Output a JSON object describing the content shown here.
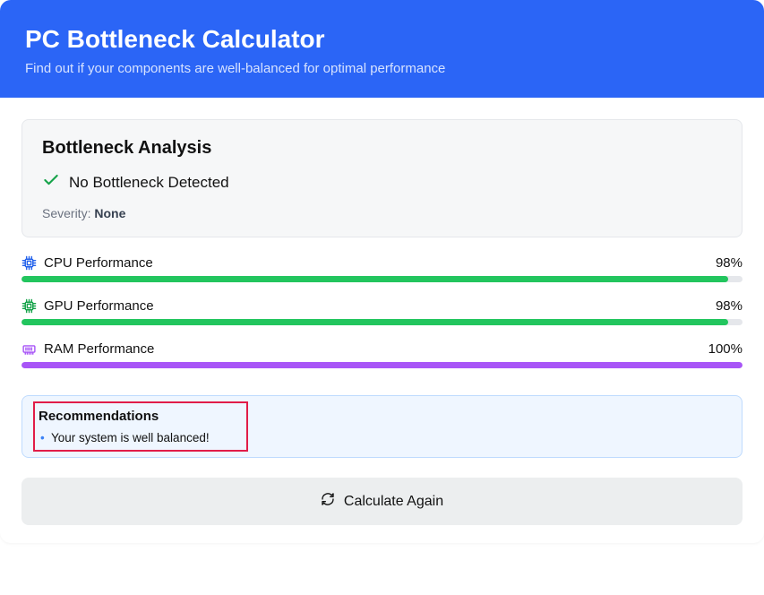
{
  "header": {
    "title": "PC Bottleneck Calculator",
    "subtitle": "Find out if your components are well-balanced for optimal performance"
  },
  "analysis": {
    "heading": "Bottleneck Analysis",
    "status": "No Bottleneck Detected",
    "severity_label": "Severity:",
    "severity_value": "None"
  },
  "metrics": {
    "cpu": {
      "label": "CPU Performance",
      "value": "98%",
      "width": "98%",
      "color": "green",
      "icon_color": "#2563eb"
    },
    "gpu": {
      "label": "GPU Performance",
      "value": "98%",
      "width": "98%",
      "color": "green",
      "icon_color": "#16a34a"
    },
    "ram": {
      "label": "RAM Performance",
      "value": "100%",
      "width": "100%",
      "color": "purple",
      "icon_color": "#a855f7"
    }
  },
  "recommendations": {
    "heading": "Recommendations",
    "items": [
      "Your system is well balanced!"
    ]
  },
  "button": {
    "label": "Calculate Again"
  }
}
